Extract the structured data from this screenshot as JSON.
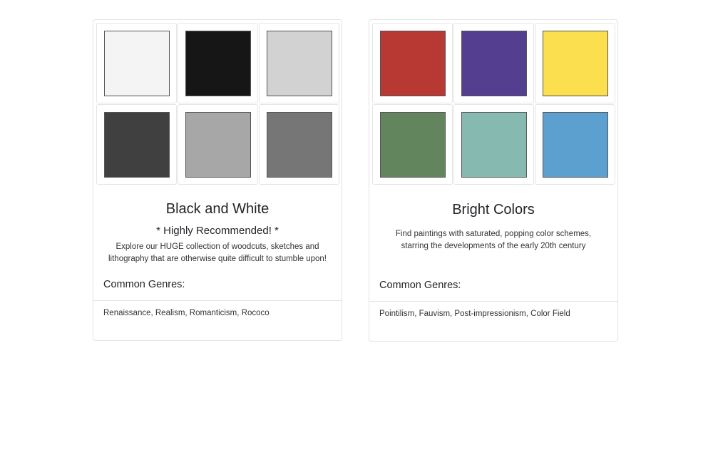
{
  "cards": [
    {
      "title": "Black and White",
      "subtitle": "* Highly Recommended! *",
      "description": "Explore our HUGE collection of woodcuts, sketches and lithography that are otherwise quite difficult to stumble upon!",
      "genres_heading": "Common Genres:",
      "genres": "Renaissance, Realism, Romanticism, Rococo",
      "swatches": [
        "#f4f4f4",
        "#161616",
        "#d2d2d2",
        "#404040",
        "#a7a7a7",
        "#767676"
      ]
    },
    {
      "title": "Bright Colors",
      "description": "Find paintings with saturated, popping color schemes, starring the developments of the early 20th century",
      "genres_heading": "Common Genres:",
      "genres": "Pointilism, Fauvism, Post-impressionism, Color Field",
      "swatches": [
        "#b83834",
        "#533e8f",
        "#fbdf4e",
        "#62855e",
        "#86bab0",
        "#5ba0ce"
      ]
    }
  ]
}
